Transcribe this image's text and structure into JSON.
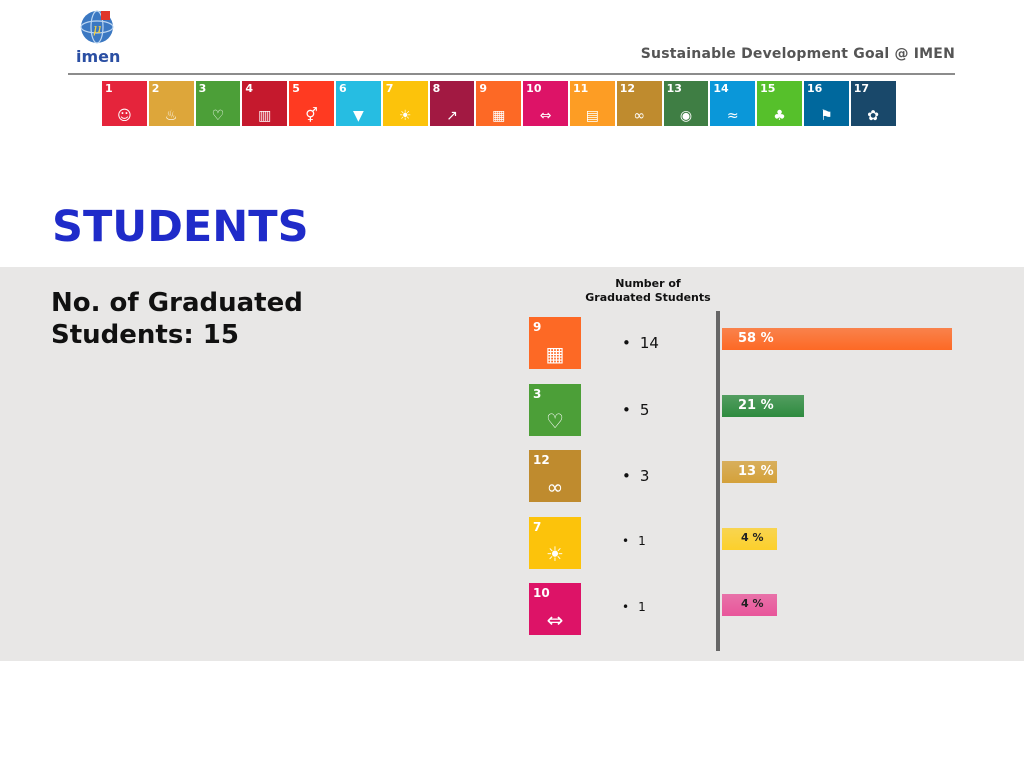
{
  "header": {
    "logo_text": "imen",
    "title": "Sustainable Development Goal  @  IMEN"
  },
  "sdg_strip": [
    {
      "num": "1",
      "color": "#e5243b",
      "icon": "people-icon"
    },
    {
      "num": "2",
      "color": "#dda63a",
      "icon": "bowl-icon"
    },
    {
      "num": "3",
      "color": "#4c9f38",
      "icon": "heartbeat-icon"
    },
    {
      "num": "4",
      "color": "#c5192d",
      "icon": "book-icon"
    },
    {
      "num": "5",
      "color": "#ff3a21",
      "icon": "gender-icon"
    },
    {
      "num": "6",
      "color": "#26bde2",
      "icon": "water-drop-icon"
    },
    {
      "num": "7",
      "color": "#fcc30b",
      "icon": "sun-power-icon"
    },
    {
      "num": "8",
      "color": "#a21942",
      "icon": "growth-chart-icon"
    },
    {
      "num": "9",
      "color": "#fd6925",
      "icon": "cubes-icon"
    },
    {
      "num": "10",
      "color": "#dd1367",
      "icon": "equality-icon"
    },
    {
      "num": "11",
      "color": "#fd9d24",
      "icon": "city-icon"
    },
    {
      "num": "12",
      "color": "#bf8b2e",
      "icon": "infinity-icon"
    },
    {
      "num": "13",
      "color": "#3f7e44",
      "icon": "eye-icon"
    },
    {
      "num": "14",
      "color": "#0a97d9",
      "icon": "fish-icon"
    },
    {
      "num": "15",
      "color": "#56c02b",
      "icon": "tree-icon"
    },
    {
      "num": "16",
      "color": "#00689d",
      "icon": "dove-icon"
    },
    {
      "num": "17",
      "color": "#19486a",
      "icon": "flower-icon"
    }
  ],
  "page": {
    "heading": "STUDENTS",
    "stat_text": "No. of Graduated Students: 15"
  },
  "chart_data": {
    "type": "bar",
    "orientation": "horizontal",
    "title": "Number of Graduated Students",
    "categories": [
      "SDG 9",
      "SDG 3",
      "SDG 12",
      "SDG 7",
      "SDG 10"
    ],
    "values": [
      14,
      5,
      3,
      1,
      1
    ],
    "value_labels": [
      "14",
      "5",
      "3",
      "1",
      "1"
    ],
    "percent_labels": [
      "58 %",
      "21 %",
      "13 %",
      "4 %",
      "4 %"
    ],
    "colors": [
      "#fd6925",
      "#2e8b3f",
      "#d4a13a",
      "#fcd02b",
      "#e8559a"
    ],
    "icons": [
      "cubes-icon",
      "heartbeat-icon",
      "infinity-icon",
      "sun-power-icon",
      "equality-icon"
    ],
    "goal_numbers": [
      "9",
      "3",
      "12",
      "7",
      "10"
    ],
    "goal_colors": [
      "#fd6925",
      "#4c9f38",
      "#bf8b2e",
      "#fcc30b",
      "#dd1367"
    ],
    "xlim": [
      0,
      14
    ],
    "grid": false
  }
}
